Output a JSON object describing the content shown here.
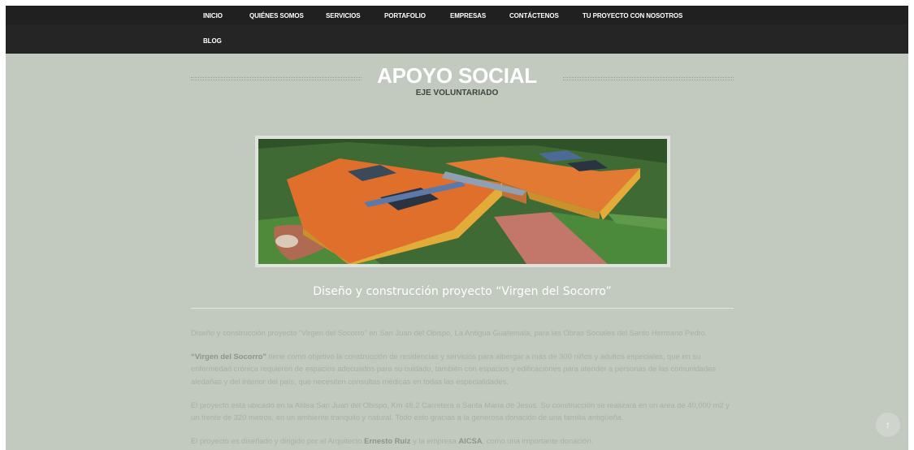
{
  "nav": {
    "items": [
      "INICIO",
      "QUIÉNES SOMOS",
      "SERVICIOS",
      "PORTAFOLIO",
      "EMPRESAS",
      "CONTÁCTENOS",
      "TU PROYECTO CON NOSOTROS"
    ],
    "blog": "BLOG"
  },
  "section": {
    "title": "APOYO SOCIAL",
    "subtitle": "EJE VOLUNTARIADO"
  },
  "project": {
    "title": "Diseño y construcción proyecto “Virgen del Socorro”",
    "p1": "Diseño y construcción proyecto “Virgen del Socorro” en San Juan del Obispo, La Antigua Guatemala, para las Obras Sociales del Santo Hermano Pedro.",
    "p2_bold": "“Virgen del Socorro”",
    "p2_rest": " tiene como objetivo la construcción de residencias y servicios para albergar a más de 300 niños y adultos especiales, que en su enfermedad crónica requieren de espacios adecuados para su cuidado, también con espacios y edificaciones para atender a personas de las comunidades aledañas y del interior del país, que necesiten consultas médicas en todas las especialidades.",
    "p3": "El proyecto está ubicado en la Aldea San Juan del Obispo, Km 46.2 Carretera a Santa María de Jesús. Su construcción se realizará en un área de 40,000 m2 y un frente de 320 metros, en un ambiente tranquilo y natural. Todo esto gracias a la generosa donación de una familia antigüeña.",
    "p4_a": "El proyecto es diseñado y dirigido por el Arquitecto ",
    "p4_architect": "Ernesto Ruiz",
    "p4_b": " y la empresa ",
    "p4_company": "AICSA",
    "p4_c": ", como una importante donación."
  },
  "back_to_top_icon": "arrow-up-icon",
  "colors": {
    "nav_bg": "#242524",
    "page_bg": "#c2c9bf",
    "body_text": "#a9b0a6"
  }
}
